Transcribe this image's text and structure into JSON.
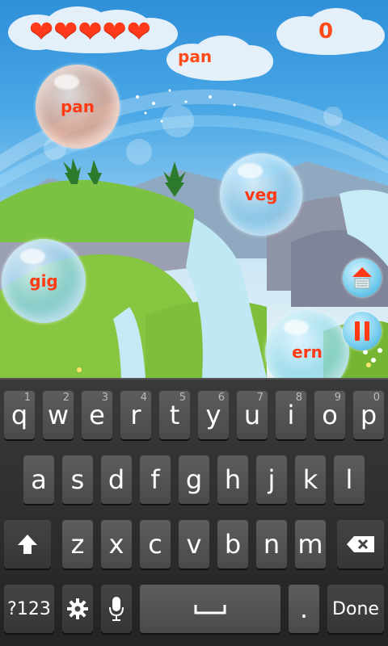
{
  "game": {
    "lives": [
      "❤",
      "❤",
      "❤",
      "❤",
      "❤"
    ],
    "score": "0",
    "target_word": "pan",
    "bubbles": {
      "pan": "pan",
      "veg": "veg",
      "gig": "gig",
      "ern": "ern"
    },
    "colors": {
      "word": "#ff3a14",
      "heart": "#ff3a1a"
    }
  },
  "keyboard": {
    "row1": [
      {
        "label": "q",
        "hint": "1"
      },
      {
        "label": "w",
        "hint": "2"
      },
      {
        "label": "e",
        "hint": "3"
      },
      {
        "label": "r",
        "hint": "4"
      },
      {
        "label": "t",
        "hint": "5"
      },
      {
        "label": "y",
        "hint": "6"
      },
      {
        "label": "u",
        "hint": "7"
      },
      {
        "label": "i",
        "hint": "8"
      },
      {
        "label": "o",
        "hint": "9"
      },
      {
        "label": "p",
        "hint": "0"
      }
    ],
    "row2": [
      "a",
      "s",
      "d",
      "f",
      "g",
      "h",
      "j",
      "k",
      "l"
    ],
    "row3": [
      "z",
      "x",
      "c",
      "v",
      "b",
      "n",
      "m"
    ],
    "symbols_label": "?123",
    "period_label": ".",
    "done_label": "Done",
    "icons": [
      "shift-icon",
      "backspace-icon",
      "settings-icon",
      "microphone-icon",
      "space-icon"
    ]
  }
}
